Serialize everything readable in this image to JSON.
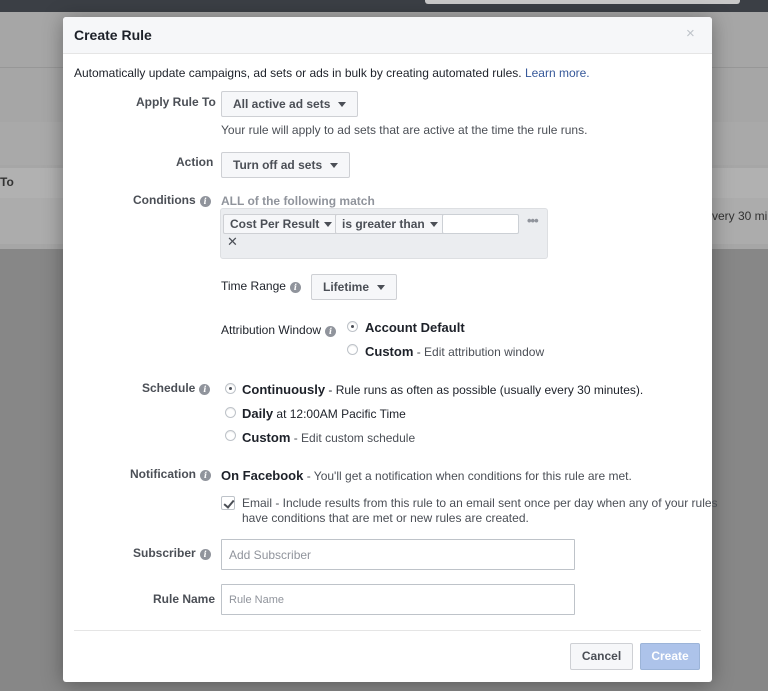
{
  "background": {
    "column_header": "To",
    "cell_fragment": "very 30 mi"
  },
  "modal": {
    "title": "Create Rule",
    "close_glyph": "×",
    "intro_text": "Automatically update campaigns, ad sets or ads in bulk by creating automated rules.",
    "learn_more": "Learn more."
  },
  "apply_rule": {
    "label": "Apply Rule To",
    "value": "All active ad sets",
    "help": "Your rule will apply to ad sets that are active at the time the rule runs."
  },
  "action": {
    "label": "Action",
    "value": "Turn off ad sets"
  },
  "conditions": {
    "label": "Conditions",
    "match_text": "ALL of the following match",
    "metric": "Cost Per Result",
    "operator": "is greater than",
    "value": "",
    "more_glyph": "•••",
    "remove_glyph": "✕"
  },
  "time_range": {
    "label": "Time Range",
    "value": "Lifetime"
  },
  "attribution": {
    "label": "Attribution Window",
    "options": [
      {
        "title": "Account Default",
        "desc": "",
        "selected": true
      },
      {
        "title": "Custom",
        "desc": " - Edit attribution window",
        "selected": false
      }
    ]
  },
  "schedule": {
    "label": "Schedule",
    "options": [
      {
        "title": "Continuously",
        "desc": " - Rule runs as often as possible (usually every 30 minutes).",
        "selected": true
      },
      {
        "title": "Daily",
        "desc": " at 12:00AM Pacific Time",
        "selected": false
      },
      {
        "title": "Custom",
        "desc": " - Edit custom schedule",
        "selected": false
      }
    ]
  },
  "notification": {
    "label": "Notification",
    "facebook_title": "On Facebook",
    "facebook_desc": " - You'll get a notification when conditions for this rule are met.",
    "email_line1": "Email - Include results from this rule to an email sent once per day when any of your rules",
    "email_line2": "have conditions that are met or new rules are created.",
    "email_checked": true
  },
  "subscriber": {
    "label": "Subscriber",
    "placeholder": "Add Subscriber",
    "value": ""
  },
  "rule_name": {
    "label": "Rule Name",
    "placeholder": "Rule Name",
    "value": ""
  },
  "footer": {
    "cancel_label": "Cancel",
    "create_label": "Create"
  },
  "icons": {
    "info": "i"
  }
}
